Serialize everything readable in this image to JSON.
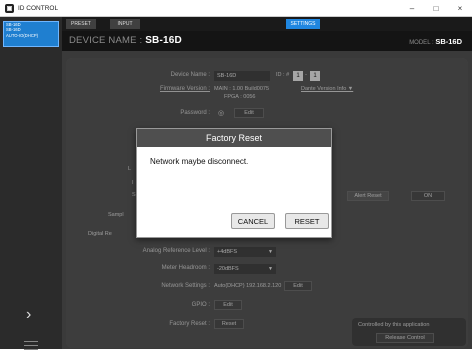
{
  "window": {
    "title": "ID CONTROL",
    "minimize": "–",
    "maximize": "□",
    "close": "×"
  },
  "left_panel": {
    "device_card": {
      "line1": "SB-16D",
      "line2": "SB-16D",
      "line3": "AUTO-IO(DHCP)",
      "line4": ""
    },
    "chevron": "›"
  },
  "tabs": {
    "preset": "PRESET",
    "input": "INPUT",
    "settings": "SETTINGS"
  },
  "device_header": {
    "prefix": "DEVICE NAME : ",
    "name": "SB-16D",
    "model_prefix": "MODEL : ",
    "model": "SB-16D"
  },
  "settings": {
    "device_name_label": "Device Name :",
    "device_name_value": "SB-16D",
    "id_label": "ID : #",
    "id_a": "1",
    "id_b": "1",
    "firmware_label": "Firmware Version :",
    "firmware_main": "MAIN : 1.00 Build0075",
    "firmware_fpga": "FPGA : 0056",
    "dante_label": "Dante Version Info ▼",
    "password_label": "Password :",
    "password_icon": "◎",
    "edit": "Edit",
    "partial_l1": "L",
    "partial_l2": "I",
    "partial_l3": "S",
    "sample_label": "Sampl",
    "digital_label": "Digital Re",
    "alert_reset": "Alert Reset",
    "on_label": "ON",
    "analog_ref_label": "Analog Reference Level :",
    "analog_ref_value": "+4dBFS",
    "meter_label": "Meter Headroom :",
    "meter_value": "-20dBFS",
    "network_label": "Network Settings :",
    "network_value": "Auto(DHCP) 192.168.2.120",
    "gpio_label": "GPIO :",
    "factory_label": "Factory Reset :",
    "reset_btn": "Reset",
    "controlled_by": "Controlled by this application",
    "release_control": "Release Control"
  },
  "dialog": {
    "title": "Factory Reset",
    "message": "Network maybe disconnect.",
    "cancel": "CANCEL",
    "reset": "RESET"
  }
}
